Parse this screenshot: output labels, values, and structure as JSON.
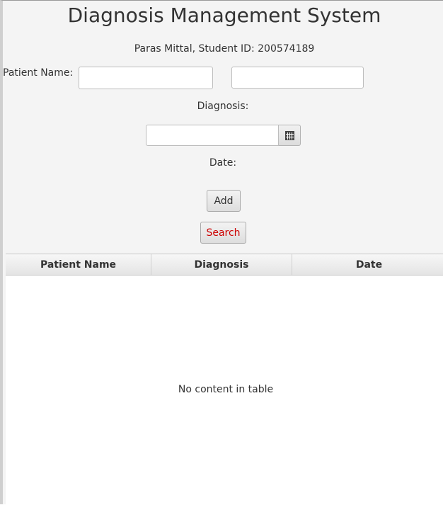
{
  "app": {
    "title": "Diagnosis Management System",
    "subtitle": "Paras Mittal, Student ID: 200574189"
  },
  "form": {
    "patient_name_label": "Patient Name:",
    "patient_name_value": "",
    "second_field_value": "",
    "diagnosis_label": "Diagnosis:",
    "date_value": "",
    "date_label": "Date:",
    "date_picker_icon": "calendar-icon"
  },
  "buttons": {
    "add_label": "Add",
    "search_label": "Search",
    "search_color": "#cc0000"
  },
  "table": {
    "columns": [
      "Patient Name",
      "Diagnosis",
      "Date"
    ],
    "rows": [],
    "empty_message": "No content in table"
  }
}
